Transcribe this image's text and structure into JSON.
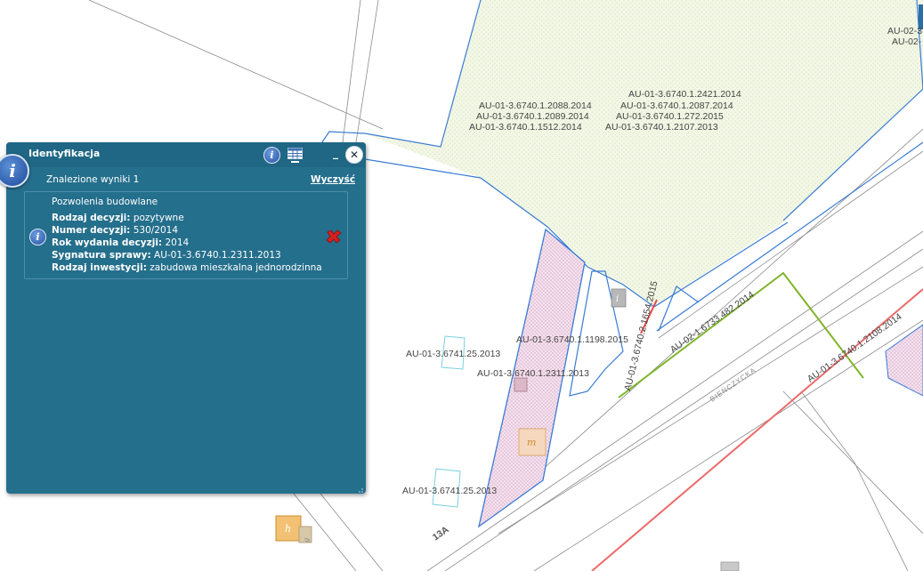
{
  "map": {
    "labels": {
      "au_2088": "AU-01-3.6740.1.2088.2014",
      "au_2089": "AU-01-3.6740.1.2089.2014",
      "au_1512": "AU-01-3.6740.1.1512.2014",
      "au_2421": "AU-01-3.6740.1.2421.2014",
      "au_2087": "AU-01-3.6740.1.2087.2014",
      "au_272": "AU-01-3.6740.1.272.2015",
      "au_2107": "AU-01-3.6740.1.2107.2013",
      "au_1198": "AU-01-3.6740.1.1198.2015",
      "au_2311": "AU-01-3.6740.1.2311.2013",
      "au_6741_top": "AU-01-3.6741.25.2013",
      "au_6741_bottom": "AU-01-3.6741.25.2013",
      "au_1654": "AU-01-3.6740.2.1654.2015",
      "au_482": "AU-02-1.6733.482.2014",
      "au_2108": "AU-01-3.6740.1.2108.2014",
      "au_edge1": "AU-02-3",
      "au_edge2": "AU-02-",
      "street": "BIEŃCZYCKA",
      "house_number": "13A",
      "bld_i": "i",
      "bld_m": "m",
      "bld_h": "h",
      "bld_g": "g"
    }
  },
  "panel": {
    "title": "Identyfikacja",
    "results_count": "Znalezione wyniki 1",
    "clear_label": "Wyczyść",
    "min_label": "_",
    "close_label": "✕",
    "info_glyph": "i",
    "result": {
      "layer": "Pozwolenia budowlane",
      "attributes": [
        {
          "label": "Rodzaj decyzji:",
          "value": "pozytywne"
        },
        {
          "label": "Numer decyzji:",
          "value": "530/2014"
        },
        {
          "label": "Rok wydania decyzji:",
          "value": "2014"
        },
        {
          "label": "Sygnatura sprawy:",
          "value": "AU-01-3.6740.1.2311.2013"
        },
        {
          "label": "Rodzaj inwestycji:",
          "value": "zabudowa mieszkalna jednorodzinna"
        }
      ]
    }
  },
  "colors": {
    "panel_bg": "#246f8c",
    "parcel_blue": "#3b7fd6",
    "zone_fill": "#f1f6e4",
    "pink_fill": "#f3dcea",
    "green_line": "#7fb52a",
    "red_line": "#e85a5a"
  },
  "icons": [
    "info-icon",
    "table-icon",
    "minimize-icon",
    "close-icon",
    "delete-icon",
    "resize-grip-icon"
  ]
}
